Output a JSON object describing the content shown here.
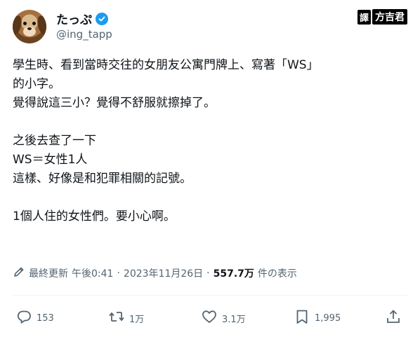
{
  "user": {
    "display_name": "たっぷ",
    "handle": "@ing_tapp"
  },
  "watermark": {
    "label": "譯",
    "name": "方吉君"
  },
  "tweet": {
    "lines": [
      "學生時、看到當時交往的女朋友公寓門牌上、寫著「WS」",
      "的小字。",
      "覺得說這三小？覺得不舒服就擦掉了。",
      "",
      "之後去查了一下",
      "WS＝女性1人",
      "這樣、好像是和犯罪相關的記號。",
      "",
      "1個人住的女性們。要小心啊。"
    ]
  },
  "meta": {
    "edited": "最終更新",
    "time": "午後0:41",
    "separator": "·",
    "date": "2023年11月26日",
    "views_count": "557.7万",
    "views_label": "件の表示"
  },
  "actions": {
    "replies": "153",
    "retweets": "1万",
    "likes": "3.1万",
    "bookmarks": "1,995"
  },
  "colors": {
    "text": "#0f1419",
    "secondary": "#536471",
    "verified": "#1d9bf0",
    "divider": "#eff3f4"
  }
}
